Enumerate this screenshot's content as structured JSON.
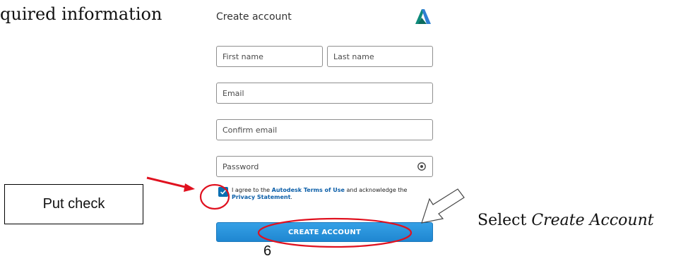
{
  "annotation": {
    "left_title": "quired information",
    "put_check": "Put check",
    "select_prefix": "Select ",
    "select_target": "Create Account",
    "page_number": "6",
    "highlight_color": "#e0111f"
  },
  "form": {
    "title": "Create account",
    "logo": "autodesk-logo-icon",
    "fields": {
      "first_name": "First name",
      "last_name": "Last name",
      "email": "Email",
      "confirm_email": "Confirm email",
      "password": "Password"
    },
    "terms": {
      "checked": true,
      "text_1": "I agree to the ",
      "terms_link": "Autodesk Terms of Use",
      "text_2": " and acknowledge the ",
      "privacy_link": "Privacy Statement",
      "text_3": "."
    },
    "submit_label": "CREATE ACCOUNT",
    "accent_color": "#1f87d1"
  }
}
